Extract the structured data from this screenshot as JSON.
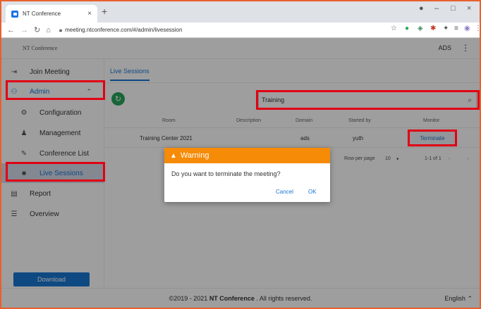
{
  "browser": {
    "tab_title": "NT Conference",
    "tab_close": "×",
    "new_tab": "+",
    "url": "meeting.ntconference.com/#/admin/livesession",
    "win_min": "–",
    "win_max": "□",
    "win_close": "×"
  },
  "header": {
    "brand": "NT Conference",
    "user": "ADS",
    "menu": "⋮"
  },
  "sidebar": {
    "join_meeting": "Join Meeting",
    "admin": "Admin",
    "configuration": "Configuration",
    "management": "Management",
    "conference_list": "Conference List",
    "live_sessions": "Live Sessions",
    "report": "Report",
    "overview": "Overview",
    "download": "Download"
  },
  "main": {
    "tab": "Live Sessions",
    "search_value": "Training",
    "columns": [
      "Room",
      "Description",
      "Domain",
      "Started by",
      "Monitor"
    ],
    "row": {
      "room": "Training Center 2021",
      "description": "",
      "domain": "ads",
      "started_by": "yuth",
      "monitor": "Terminate"
    },
    "pager": {
      "rows_per_page_label": "Row per page",
      "rows_per_page": "10",
      "range": "1-1 of 1"
    }
  },
  "dialog": {
    "title": "Warning",
    "message": "Do you want to terminate the meeting?",
    "cancel": "Cancel",
    "ok": "OK"
  },
  "footer": {
    "copyright_prefix": "©2019 - 2021 ",
    "copyright_brand": "NT Conference",
    "copyright_suffix": " . All rights reserved.",
    "language": "English"
  },
  "colors": {
    "accent": "#1976d2",
    "warning": "#f58b07",
    "refresh": "#27a35a",
    "annotation": "#e10014"
  }
}
